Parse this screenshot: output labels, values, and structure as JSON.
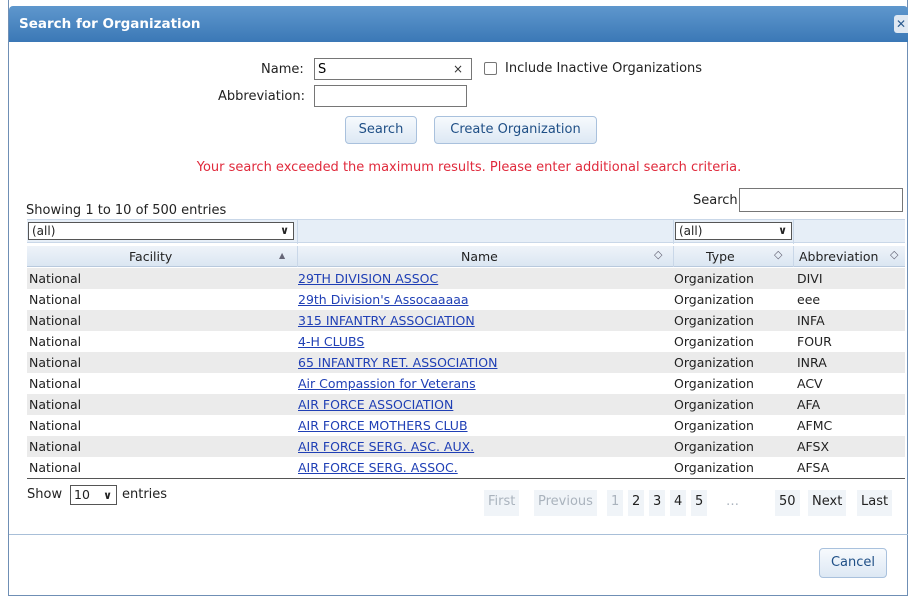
{
  "dialog": {
    "title": "Search for Organization",
    "close_glyph": "✕"
  },
  "form": {
    "name_label": "Name:",
    "name_value": "S",
    "clear_glyph": "×",
    "include_inactive_label": "Include Inactive Organizations",
    "include_inactive_checked": false,
    "abbreviation_label": "Abbreviation:",
    "abbreviation_value": "",
    "search_button": "Search",
    "create_button": "Create Organization"
  },
  "error_message": "Your search exceeded the maximum results. Please enter additional search criteria.",
  "table": {
    "info": "Showing 1 to 10 of 500 entries",
    "search_label": "Search:",
    "search_value": "",
    "filters": {
      "facility": "(all)",
      "type": "(all)"
    },
    "columns": [
      "Facility",
      "Name",
      "Type",
      "Abbreviation"
    ],
    "sort_icons": {
      "facility": "▲",
      "name": "◇",
      "type": "◇",
      "abbreviation": "◇"
    },
    "rows": [
      {
        "facility": "National",
        "name": "29TH DIVISION ASSOC",
        "type": "Organization",
        "abbreviation": "DIVI"
      },
      {
        "facility": "National",
        "name": "29th Division's Assocaaaaa",
        "type": "Organization",
        "abbreviation": "eee"
      },
      {
        "facility": "National",
        "name": "315 INFANTRY ASSOCIATION",
        "type": "Organization",
        "abbreviation": "INFA"
      },
      {
        "facility": "National",
        "name": "4-H CLUBS",
        "type": "Organization",
        "abbreviation": "FOUR"
      },
      {
        "facility": "National",
        "name": "65 INFANTRY RET. ASSOCIATION",
        "type": "Organization",
        "abbreviation": "INRA"
      },
      {
        "facility": "National",
        "name": "Air Compassion for Veterans",
        "type": "Organization",
        "abbreviation": "ACV"
      },
      {
        "facility": "National",
        "name": "AIR FORCE ASSOCIATION",
        "type": "Organization",
        "abbreviation": "AFA"
      },
      {
        "facility": "National",
        "name": "AIR FORCE MOTHERS CLUB",
        "type": "Organization",
        "abbreviation": "AFMC"
      },
      {
        "facility": "National",
        "name": "AIR FORCE SERG. ASC. AUX.",
        "type": "Organization",
        "abbreviation": "AFSX"
      },
      {
        "facility": "National",
        "name": "AIR FORCE SERG. ASSOC.",
        "type": "Organization",
        "abbreviation": "AFSA"
      }
    ]
  },
  "length_menu": {
    "show": "Show",
    "value": "10",
    "entries": "entries"
  },
  "pagination": {
    "first": "First",
    "previous": "Previous",
    "pages": [
      "1",
      "2",
      "3",
      "4",
      "5"
    ],
    "current": "1",
    "ellipsis": "…",
    "last_page": "50",
    "next": "Next",
    "last": "Last"
  },
  "footer": {
    "cancel_button": "Cancel"
  },
  "colors": {
    "titlebar": "#3b78b6",
    "error": "#e02a3c",
    "link": "#1f3fb5",
    "odd_row": "#ebebeb"
  }
}
